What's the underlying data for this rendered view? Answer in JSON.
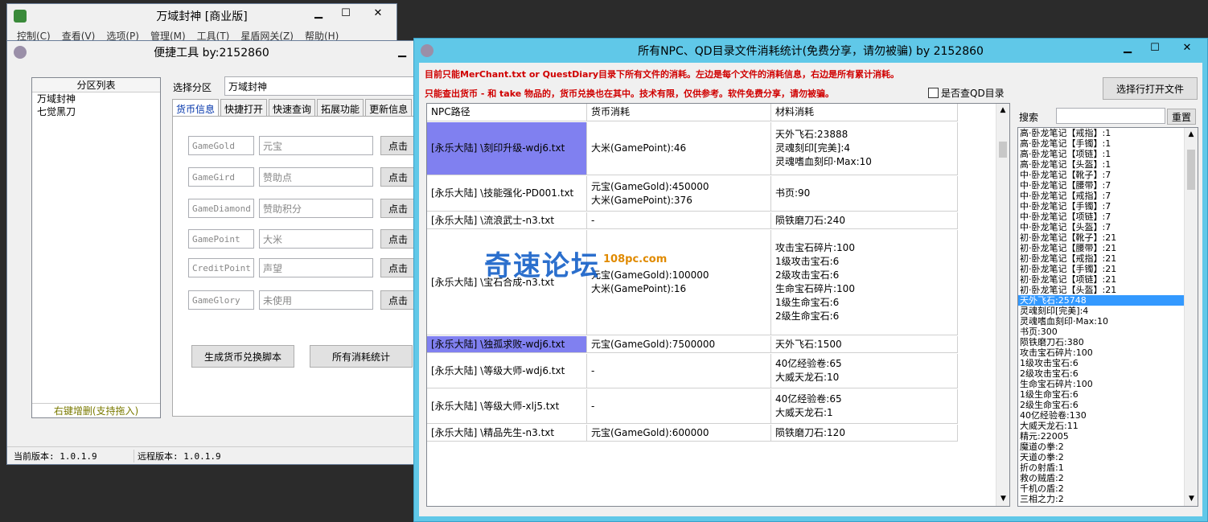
{
  "main_window": {
    "title": "万域封神 [商业版]",
    "menu": [
      "控制(C)",
      "查看(V)",
      "选项(P)",
      "管理(M)",
      "工具(T)",
      "星盾网关(Z)",
      "帮助(H)"
    ]
  },
  "tools_window": {
    "title": "便捷工具 by:2152860",
    "partition_header": "分区列表",
    "partitions": [
      "万域封神",
      "七觉黑刀"
    ],
    "partition_footer": "右键增删(支持拖入)",
    "select_label": "选择分区",
    "select_value": "万域封神",
    "tabs": [
      "货币信息",
      "快捷打开",
      "快速查询",
      "拓展功能",
      "更新信息"
    ],
    "currencies": [
      {
        "code": "GameGold",
        "name": "元宝"
      },
      {
        "code": "GameGird",
        "name": "赞助点"
      },
      {
        "code": "GameDiamond",
        "name": "赞助积分"
      },
      {
        "code": "GamePoint",
        "name": "大米"
      },
      {
        "code": "CreditPoint",
        "name": "声望"
      },
      {
        "code": "GameGlory",
        "name": "未使用"
      }
    ],
    "click_label": "点击",
    "gen_button": "生成货币兑换脚本",
    "stats_button": "所有消耗统计",
    "status_local": "当前版本: 1.0.1.9",
    "status_remote": "远程版本: 1.0.1.9"
  },
  "stats_window": {
    "title": "所有NPC、QD目录文件消耗统计(免费分享，请勿被骗)   by 2152860",
    "notice1": "目前只能MerChant.txt or QuestDiary目录下所有文件的消耗。左边是每个文件的消耗信息，右边是所有累计消耗。",
    "notice2": "只能查出货币 - 和 take 物品的，货币兑换也在其中。技术有限，仅供参考。软件免费分享，请勿被骗。",
    "checkbox_label": "是否查QD目录",
    "open_button": "选择行打开文件",
    "search_label": "搜索",
    "reset_button": "重置",
    "columns": [
      "NPC路径",
      "货币消耗",
      "材料消耗"
    ],
    "rows": [
      {
        "path": "[永乐大陆] \\刻印升级-wdj6.txt",
        "cost": "大米(GamePoint):46",
        "mat": "天外飞石:23888\n灵魂刻印[完美]:4\n灵魂嗜血刻印·Max:10"
      },
      {
        "path": "[永乐大陆] \\技能强化-PD001.txt",
        "cost": "元宝(GameGold):450000\n大米(GamePoint):376",
        "mat": "书页:90"
      },
      {
        "path": "[永乐大陆] \\流浪武士-n3.txt",
        "cost": "-",
        "mat": "陨铁磨刀石:240"
      },
      {
        "path": "[永乐大陆] \\宝石合成-n3.txt",
        "cost": "元宝(GameGold):100000\n大米(GamePoint):16",
        "mat": "攻击宝石碎片:100\n1级攻击宝石:6\n2级攻击宝石:6\n生命宝石碎片:100\n1级生命宝石:6\n2级生命宝石:6"
      },
      {
        "path": "[永乐大陆] \\独孤求败-wdj6.txt",
        "cost": "元宝(GameGold):7500000",
        "mat": "天外飞石:1500"
      },
      {
        "path": "[永乐大陆] \\等级大师-wdj6.txt",
        "cost": "-",
        "mat": "40亿经验卷:65\n大威天龙石:10"
      },
      {
        "path": "[永乐大陆] \\等级大师-xlj5.txt",
        "cost": "-",
        "mat": "40亿经验卷:65\n大威天龙石:1"
      },
      {
        "path": "[永乐大陆] \\精品先生-n3.txt",
        "cost": "元宝(GameGold):600000",
        "mat": "陨铁磨刀石:120"
      }
    ],
    "totals": [
      "高·卧龙笔记【戒指】:1",
      "高·卧龙笔记【手镯】:1",
      "高·卧龙笔记【项链】:1",
      "高·卧龙笔记【头盔】:1",
      "中·卧龙笔记【靴子】:7",
      "中·卧龙笔记【腰带】:7",
      "中·卧龙笔记【戒指】:7",
      "中·卧龙笔记【手镯】:7",
      "中·卧龙笔记【项链】:7",
      "中·卧龙笔记【头盔】:7",
      "初·卧龙笔记【靴子】:21",
      "初·卧龙笔记【腰带】:21",
      "初·卧龙笔记【戒指】:21",
      "初·卧龙笔记【手镯】:21",
      "初·卧龙笔记【项链】:21",
      "初·卧龙笔记【头盔】:21",
      "天外飞石:25748",
      "灵魂刻印[完美]:4",
      "灵魂嗜血刻印·Max:10",
      "书页:300",
      "陨铁磨刀石:380",
      "攻击宝石碎片:100",
      "1级攻击宝石:6",
      "2级攻击宝石:6",
      "生命宝石碎片:100",
      "1级生命宝石:6",
      "2级生命宝石:6",
      "40亿经验卷:130",
      "大威天龙石:11",
      "精元:22005",
      "魔道の拳:2",
      "天道の拳:2",
      "折の射盾:1",
      "救の贼盾:2",
      "千机の盾:2",
      "三相之力:2"
    ],
    "watermark": "奇速论坛",
    "watermark_sub": "108pc.com"
  }
}
